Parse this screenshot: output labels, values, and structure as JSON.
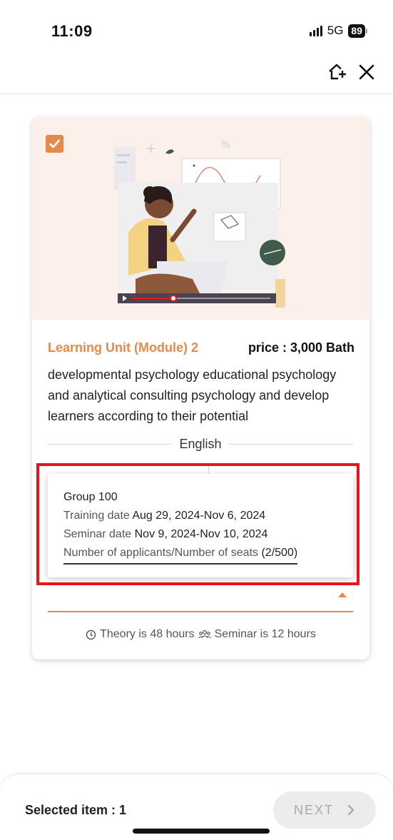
{
  "status_bar": {
    "time": "11:09",
    "network": "5G",
    "battery": "89"
  },
  "top_nav": {
    "icons": [
      "add-home-icon",
      "close-icon"
    ]
  },
  "course_card": {
    "selected": true,
    "module_title": "Learning Unit (Module) 2",
    "price": "price : 3,000 Bath",
    "description": "developmental psychology educational psychology and analytical consulting psychology and develop learners according to their potential",
    "language": "English",
    "group": {
      "name": "Group 100",
      "training_label": "Training date",
      "training_value": "Aug 29, 2024-Nov 6, 2024",
      "seminar_label": "Seminar date",
      "seminar_value": "Nov 9, 2024-Nov 10, 2024",
      "seats_label": "Number of applicants/Number of seats",
      "seats_value": "(2/500)"
    },
    "theory_hours": "Theory is 48 hours",
    "seminar_hours": "Seminar is 12 hours"
  },
  "bottom_bar": {
    "selected_text": "Selected item : 1",
    "next_label": "NEXT"
  },
  "colors": {
    "accent": "#e48a4c",
    "highlight": "#e8151b",
    "hero_bg": "#fbf1ea"
  }
}
